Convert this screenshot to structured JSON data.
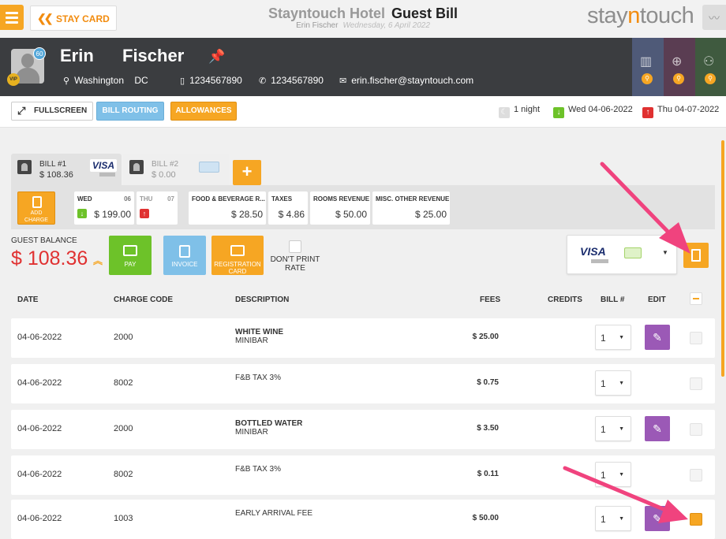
{
  "header": {
    "stay_card_label": "STAY CARD",
    "hotel_name": "Stayntouch Hotel",
    "page_title": "Guest Bill",
    "guest_name_sub": "Erin Fischer",
    "date_sub": "Wednesday, 6 April 2022",
    "logo_part1": "stay",
    "logo_part2": "n",
    "logo_part3": "touch"
  },
  "guest": {
    "first_name": "Erin",
    "last_name": "Fischer",
    "badge_count": "60",
    "vip_label": "VIP",
    "city": "Washington",
    "state": "DC",
    "mobile": "1234567890",
    "phone": "1234567890",
    "email": "erin.fischer@stayntouch.com"
  },
  "actions": {
    "fullscreen": "FULLSCREEN",
    "bill_routing": "BILL ROUTING",
    "allowances": "ALLOWANCES"
  },
  "stay": {
    "nights": "1 night",
    "arrival": "Wed 04-06-2022",
    "departure": "Thu 04-07-2022"
  },
  "bills": [
    {
      "label": "BILL #1",
      "amount": "$ 108.36",
      "card": "VISA"
    },
    {
      "label": "BILL #2",
      "amount": "$ 0.00"
    }
  ],
  "add_bill_label": "+",
  "add_charge_label": "ADD CHARGE",
  "summary": {
    "day1_label": "WED",
    "day1_num": "06",
    "day1_amount": "$ 199.00",
    "day2_label": "THU",
    "day2_num": "07",
    "fnb_label": "FOOD & BEVERAGE R...",
    "fnb_amount": "$ 28.50",
    "taxes_label": "TAXES",
    "taxes_amount": "$ 4.86",
    "rooms_label": "ROOMS REVENUE",
    "rooms_amount": "$ 50.00",
    "misc_label": "MISC. OTHER REVENUE",
    "misc_amount": "$ 25.00"
  },
  "balance": {
    "label": "GUEST BALANCE",
    "amount": "$ 108.36",
    "pay": "PAY",
    "invoice": "INVOICE",
    "registration_card": "REGISTRATION CARD",
    "dont_print_rate": "DON'T PRINT RATE",
    "card_brand": "VISA"
  },
  "table": {
    "headers": {
      "date": "DATE",
      "charge_code": "CHARGE CODE",
      "description": "DESCRIPTION",
      "fees": "FEES",
      "credits": "CREDITS",
      "bill": "BILL #",
      "edit": "EDIT"
    },
    "rows": [
      {
        "date": "04-06-2022",
        "code": "2000",
        "desc1": "WHITE WINE",
        "desc2": "MINIBAR",
        "fees": "$ 25.00",
        "bill": "1"
      },
      {
        "date": "04-06-2022",
        "code": "8002",
        "desc1": "F&B TAX 3%",
        "desc2": "",
        "fees": "$ 0.75",
        "bill": "1"
      },
      {
        "date": "04-06-2022",
        "code": "2000",
        "desc1": "BOTTLED WATER",
        "desc2": "MINIBAR",
        "fees": "$ 3.50",
        "bill": "1"
      },
      {
        "date": "04-06-2022",
        "code": "8002",
        "desc1": "F&B TAX 3%",
        "desc2": "",
        "fees": "$ 0.11",
        "bill": "1"
      },
      {
        "date": "04-06-2022",
        "code": "1003",
        "desc1": "EARLY ARRIVAL FEE",
        "desc2": "",
        "fees": "$ 50.00",
        "bill": "1"
      }
    ]
  },
  "colors": {
    "accent": "#f6a623",
    "pay": "#6dc229",
    "info": "#7fc0e8",
    "edit": "#9b59b6",
    "balance": "#e03131",
    "annotation_arrow": "#f0437e"
  }
}
